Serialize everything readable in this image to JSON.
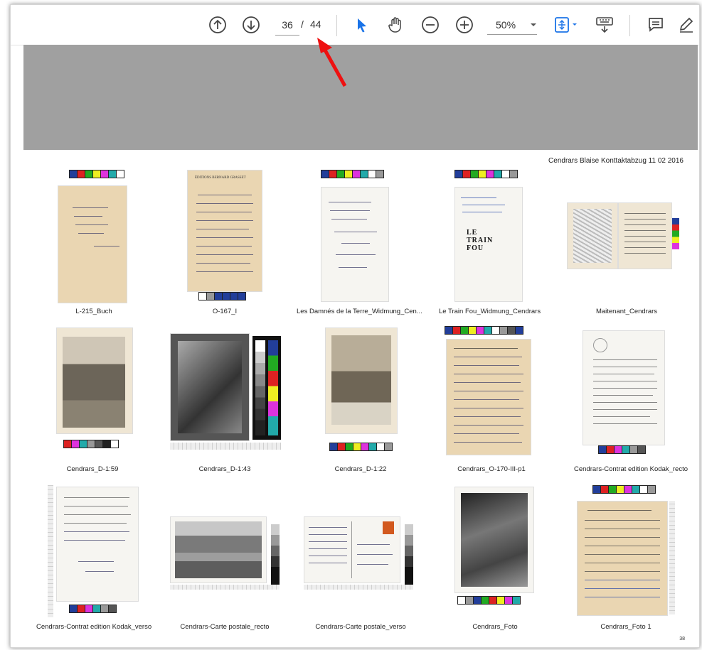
{
  "toolbar": {
    "current_page": "36",
    "separator": "/",
    "total_pages": "44",
    "zoom": "50%"
  },
  "sheet_title": "Cendrars Blaise Konttaktabzug 11 02 2016",
  "thumbnails": [
    "L-215_Buch",
    "O-167_I",
    "Les Damnés de la Terre_Widmung_Cen...",
    "Le Train Fou_Widmung_Cendrars",
    "Maitenant_Cendrars",
    "Cendrars_D-1:59",
    "Cendrars_D-1:43",
    "Cendrars_D-1:22",
    "Cendrars_O-170-III-p1",
    "Cendrars-Contrat edition Kodak_recto",
    "Cendrars-Contrat edition Kodak_verso",
    "Cendrars-Carte postale_recto",
    "Cendrars-Carte postale_verso",
    "Cendrars_Foto",
    "Cendrars_Foto 1"
  ],
  "thumbnail_texts": {
    "train_fou_title": "LE TRAIN FOU",
    "letterhead": "ÉDITIONS BERNARD GRASSET"
  },
  "page_number": "38",
  "colors": {
    "grey_band": "#a0a0a0",
    "arrow": "#ee1111",
    "accent": "#1a73e8"
  }
}
